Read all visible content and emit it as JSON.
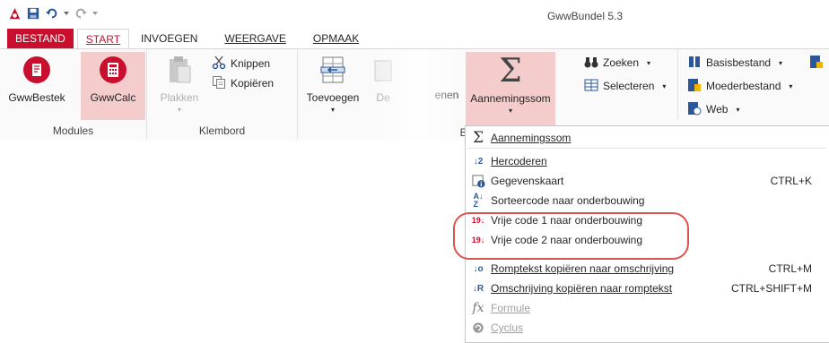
{
  "window": {
    "title": "GwwBundel 5.3"
  },
  "tabs": [
    {
      "label": "BESTAND"
    },
    {
      "label": "START"
    },
    {
      "label": "INVOEGEN"
    },
    {
      "label": "WEERGAVE"
    },
    {
      "label": "OPMAAK"
    }
  ],
  "ribbon": {
    "modules": {
      "label": "Modules",
      "gwwbestek": "GwwBestek",
      "gwwcalc": "GwwCalc"
    },
    "klembord": {
      "label": "Klembord",
      "plakken": "Plakken",
      "knippen": "Knippen",
      "kopieren": "Kopiëren"
    },
    "toevoegen": "Toevoegen",
    "delete_partial": "De",
    "rename_partial": "enen",
    "group_partial": "Be",
    "annemingssom": "Aannemingssom",
    "zoeken": "Zoeken",
    "selecteren": "Selecteren",
    "basisbestand": "Basisbestand",
    "moederbestand": "Moederbestand",
    "web": "Web"
  },
  "menu": {
    "items": [
      {
        "label": "Aannemingssom",
        "shortcut": ""
      },
      {
        "label": "Hercoderen",
        "shortcut": ""
      },
      {
        "label": "Gegevenskaart",
        "shortcut": "CTRL+K"
      },
      {
        "label": "Sorteercode naar onderbouwing",
        "shortcut": ""
      },
      {
        "label": "Vrije code 1 naar onderbouwing",
        "shortcut": ""
      },
      {
        "label": "Vrije code 2 naar onderbouwing",
        "shortcut": ""
      },
      {
        "label": "Romptekst kopiëren naar omschrijving",
        "shortcut": "CTRL+M"
      },
      {
        "label": "Omschrijving kopiëren naar romptekst",
        "shortcut": "CTRL+SHIFT+M"
      },
      {
        "label": "Formule",
        "shortcut": ""
      },
      {
        "label": "Cyclus",
        "shortcut": ""
      }
    ]
  },
  "colors": {
    "accent": "#c8102e",
    "highlight": "#f4cccc",
    "annotation": "#d9534f"
  }
}
